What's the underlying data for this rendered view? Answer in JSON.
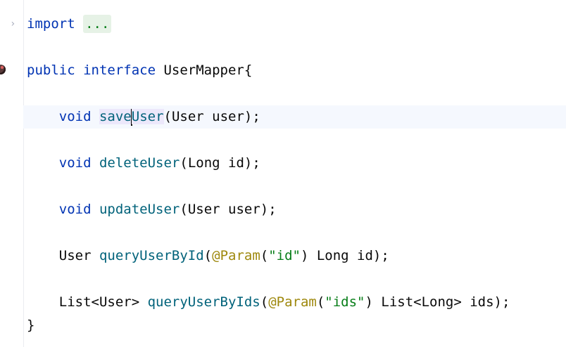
{
  "editor": {
    "language": "java",
    "lines": [
      {
        "tokens": [
          {
            "t": "import",
            "c": "kw"
          },
          {
            "t": " "
          },
          {
            "t": "...",
            "c": "fold-pill"
          }
        ]
      },
      {
        "tokens": []
      },
      {
        "tokens": [
          {
            "t": "public",
            "c": "kw"
          },
          {
            "t": " "
          },
          {
            "t": "interface",
            "c": "kw"
          },
          {
            "t": " UserMapper{"
          }
        ]
      },
      {
        "tokens": []
      },
      {
        "tokens": [
          {
            "t": "    "
          },
          {
            "t": "void",
            "c": "kw"
          },
          {
            "t": " "
          },
          {
            "t": "save",
            "c": "fn hl"
          },
          {
            "caret": true
          },
          {
            "t": "User",
            "c": "fn hl"
          },
          {
            "t": "(User user);"
          }
        ],
        "current": true
      },
      {
        "tokens": []
      },
      {
        "tokens": [
          {
            "t": "    "
          },
          {
            "t": "void",
            "c": "kw"
          },
          {
            "t": " "
          },
          {
            "t": "deleteUser",
            "c": "fn"
          },
          {
            "t": "(Long id);"
          }
        ]
      },
      {
        "tokens": []
      },
      {
        "tokens": [
          {
            "t": "    "
          },
          {
            "t": "void",
            "c": "kw"
          },
          {
            "t": " "
          },
          {
            "t": "updateUser",
            "c": "fn"
          },
          {
            "t": "(User user);"
          }
        ]
      },
      {
        "tokens": []
      },
      {
        "tokens": [
          {
            "t": "    User "
          },
          {
            "t": "queryUserById",
            "c": "fn"
          },
          {
            "t": "("
          },
          {
            "t": "@Param",
            "c": "an"
          },
          {
            "t": "("
          },
          {
            "t": "\"id\"",
            "c": "str"
          },
          {
            "t": ") Long id);"
          }
        ]
      },
      {
        "tokens": []
      },
      {
        "tokens": [
          {
            "t": "    List<User> "
          },
          {
            "t": "queryUserByIds",
            "c": "fn"
          },
          {
            "t": "("
          },
          {
            "t": "@Param",
            "c": "an"
          },
          {
            "t": "("
          },
          {
            "t": "\"ids\"",
            "c": "str"
          },
          {
            "t": ") List<Long> ids);"
          }
        ]
      },
      {
        "tokens": [
          {
            "t": "}"
          }
        ]
      }
    ]
  },
  "gutter": {
    "fold_icon": "chevron-right-icon",
    "marker_icon": "bean-marker-icon"
  }
}
